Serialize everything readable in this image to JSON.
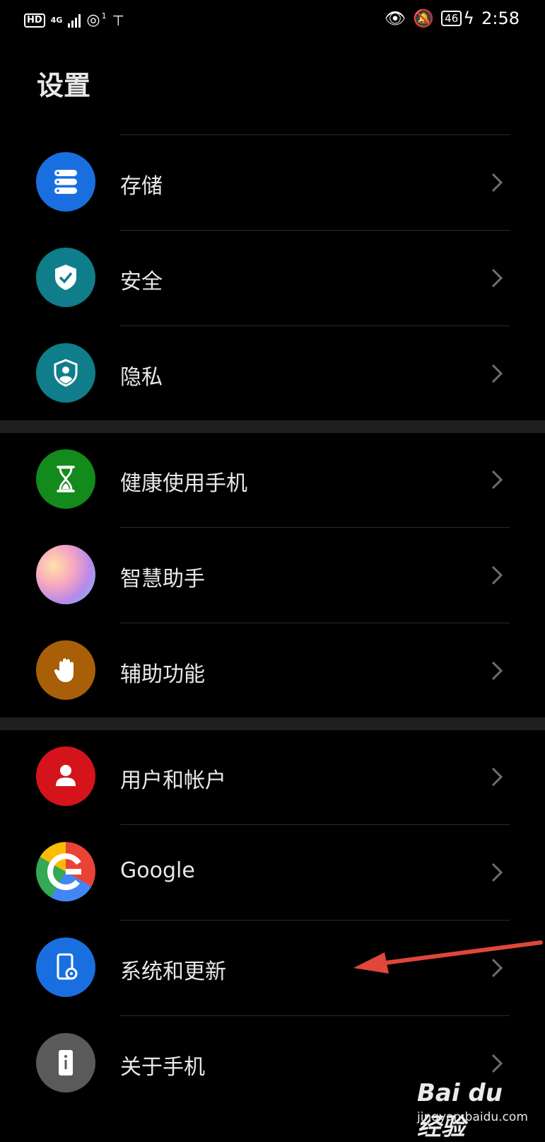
{
  "status_bar": {
    "left_badge": "HD",
    "network": "4G",
    "hotspot_count": "1",
    "battery": "46",
    "time": "2:58"
  },
  "page_title": "设置",
  "groups": [
    {
      "items": [
        {
          "label": "存储",
          "icon": "storage-icon",
          "color": "#1a6fe0"
        },
        {
          "label": "安全",
          "icon": "shield-check-icon",
          "color": "#0f7d8a"
        },
        {
          "label": "隐私",
          "icon": "privacy-shield-icon",
          "color": "#0f7d8a"
        }
      ]
    },
    {
      "items": [
        {
          "label": "健康使用手机",
          "icon": "hourglass-icon",
          "color": "#138a1c"
        },
        {
          "label": "智慧助手",
          "icon": "assistant-orb-icon",
          "color": "#d88ed0"
        },
        {
          "label": "辅助功能",
          "icon": "hand-icon",
          "color": "#a85f08"
        }
      ]
    },
    {
      "items": [
        {
          "label": "用户和帐户",
          "icon": "user-icon",
          "color": "#d4141a"
        },
        {
          "label": "Google",
          "icon": "google-icon",
          "color": "#ffffff"
        },
        {
          "label": "系统和更新",
          "icon": "system-update-icon",
          "color": "#1a6fe0"
        },
        {
          "label": "关于手机",
          "icon": "phone-info-icon",
          "color": "#5a5a5a"
        }
      ]
    }
  ],
  "annotation_color": "#e0463a",
  "watermark": {
    "brand": "Bai du 经验",
    "url": "jingyan.baidu.com"
  }
}
